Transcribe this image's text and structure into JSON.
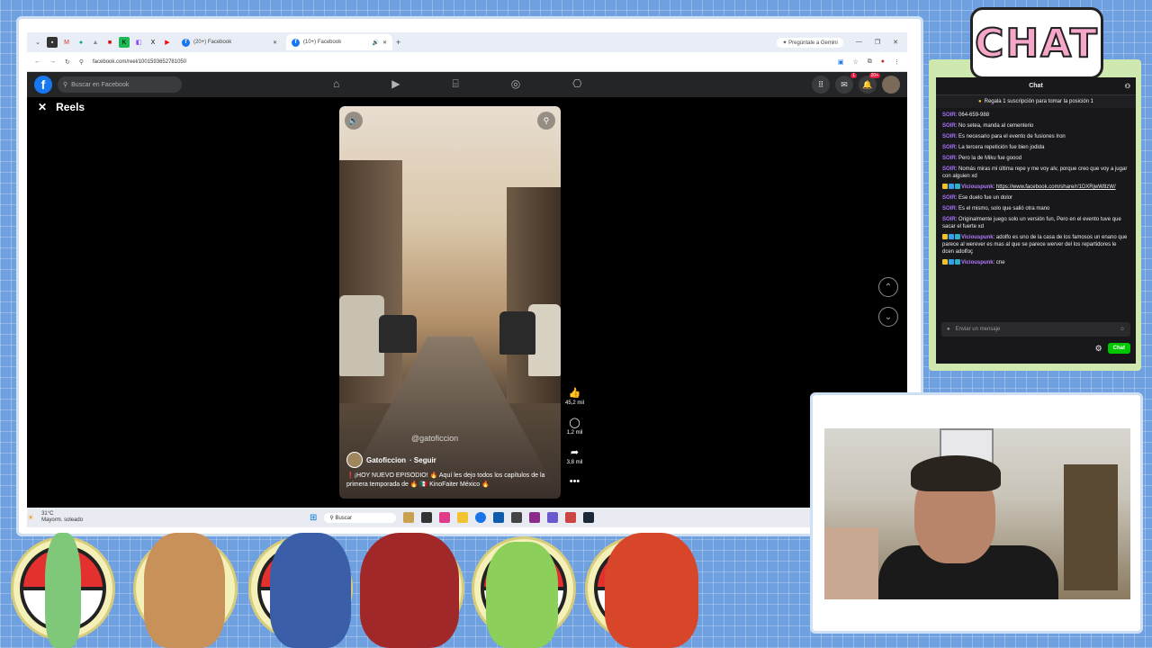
{
  "browser": {
    "tabs": [
      {
        "label": "(20+) Facebook",
        "active": false
      },
      {
        "label": "(10+) Facebook",
        "active": true
      }
    ],
    "gemini_label": "Pregúntale a Gemini",
    "url": "facebook.com/reel/1001593652781050"
  },
  "facebook": {
    "search_placeholder": "Buscar en Facebook",
    "notif_badge": "20+",
    "messenger_badge": "1",
    "section_title": "Reels",
    "reel": {
      "watermark": "@gatoficcion",
      "author": "Gatoficcion",
      "follow_label": "· Seguir",
      "caption": "❗¡HOY NUEVO EPISODIO! 🔥 Aquí les dejo todos los capítulos de la primera temporada de 🔥 🇲🇽 KinoFaiter México 🔥",
      "likes": "45,2 mil",
      "comments": "1,2 mil",
      "shares": "3,8 mil"
    }
  },
  "taskbar": {
    "temp": "31°C",
    "weather": "Mayorm. soleado",
    "search": "Buscar"
  },
  "chat": {
    "logo_text": "CHAT",
    "title": "Chat",
    "pinned": "Regala 1 suscripción para tomar la posición 1",
    "messages": [
      {
        "user": "SOIR",
        "text": "064-659-988"
      },
      {
        "user": "SOIR",
        "text": "No setea, manda al cementerio"
      },
      {
        "user": "SOIR",
        "text": "Es necesario para el evento de fusiones Iron"
      },
      {
        "user": "SOIR",
        "text": "La tercera repetición fue bien jodida"
      },
      {
        "user": "SOIR",
        "text": "Pero la de Miku fue goood"
      },
      {
        "user": "SOIR",
        "text": "Nomás miras mi última repe y me voy alv, porque creo que voy a jugar con alguien xd"
      },
      {
        "user": "Viciouspunk",
        "text": "https://www.facebook.com/share/r/1DXRjwW8zW/"
      },
      {
        "user": "SOIR",
        "text": "Ese duelo fue un dolor"
      },
      {
        "user": "SOIR",
        "text": "Es el mismo, solo que salió otra mano"
      },
      {
        "user": "SOIR",
        "text": "Originalmente juego solo un versión fun, Pero en el evento tuve que sacar el fuerte xd"
      },
      {
        "user": "Viciouspunk",
        "text": "adolfo es uno de la casa de los famosos un enano que parece al werever es mas al que se parece werver del los repartidores le dcen adolfoç"
      },
      {
        "user": "Viciouspunk",
        "text": "cne"
      }
    ],
    "input_placeholder": "Enviar un mensaje",
    "send_label": "Chat"
  },
  "colors": {
    "fb_blue": "#1877f2",
    "twitch_purple": "#a970ff",
    "chat_green": "#00c800"
  }
}
